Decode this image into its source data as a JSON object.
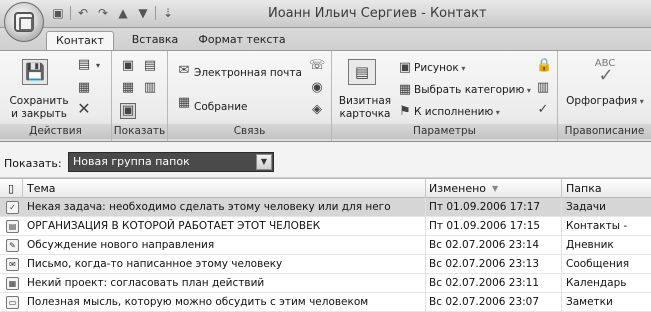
{
  "window": {
    "title": "Иоанн Ильич Сергиев - Контакт"
  },
  "quick_access": {
    "icons": [
      "save-icon",
      "undo-icon",
      "redo-icon",
      "up-arrow-icon",
      "down-arrow-icon",
      "customize-icon"
    ]
  },
  "tabs": [
    {
      "label": "Контакт",
      "active": true
    },
    {
      "label": "Вставка",
      "active": false
    },
    {
      "label": "Формат текста",
      "active": false
    }
  ],
  "ribbon": {
    "actions": {
      "label": "Действия",
      "save_close": "Сохранить\nи закрыть"
    },
    "show": {
      "label": "Показать"
    },
    "communicate": {
      "label": "Связь",
      "email": "Электронная почта",
      "meeting": "Собрание"
    },
    "options": {
      "label": "Параметры",
      "business_card": "Визитная\nкарточка",
      "picture": "Рисунок",
      "categorize": "Выбрать категорию",
      "follow_up": "К исполнению"
    },
    "proofing": {
      "label": "Правописание",
      "spelling": "Орфография",
      "abc": "ABC"
    }
  },
  "filter": {
    "show_label": "Показать:",
    "selected": "Новая группа папок"
  },
  "list": {
    "columns": {
      "subject": "Тема",
      "modified": "Изменено",
      "folder": "Папка"
    },
    "rows": [
      {
        "icon": "task-icon",
        "subject": "Некая задача: необходимо сделать этому человеку или для него",
        "modified": "Пт 01.09.2006 17:17",
        "folder": "Задачи",
        "selected": true
      },
      {
        "icon": "contact-icon",
        "subject": "ОРГАНИЗАЦИЯ В КОТОРОЙ РАБОТАЕТ ЭТОТ ЧЕЛОВЕК",
        "modified": "Пт 01.09.2006 17:15",
        "folder": "Контакты -",
        "selected": false
      },
      {
        "icon": "journal-icon",
        "subject": "Обсуждение нового направления",
        "modified": "Вс 02.07.2006 23:14",
        "folder": "Дневник",
        "selected": false
      },
      {
        "icon": "mail-icon",
        "subject": "Письмо, когда-то написанное этому человеку",
        "modified": "Вс 02.07.2006 23:13",
        "folder": "Сообщения",
        "selected": false
      },
      {
        "icon": "calendar-icon",
        "subject": "Некий проект: согласовать план действий",
        "modified": "Вс 02.07.2006 23:11",
        "folder": "Календарь",
        "selected": false
      },
      {
        "icon": "note-icon",
        "subject": "Полезная мысль, которую можно обсудить с этим человеком",
        "modified": "Вс 02.07.2006 23:07",
        "folder": "Заметки",
        "selected": false
      }
    ]
  }
}
